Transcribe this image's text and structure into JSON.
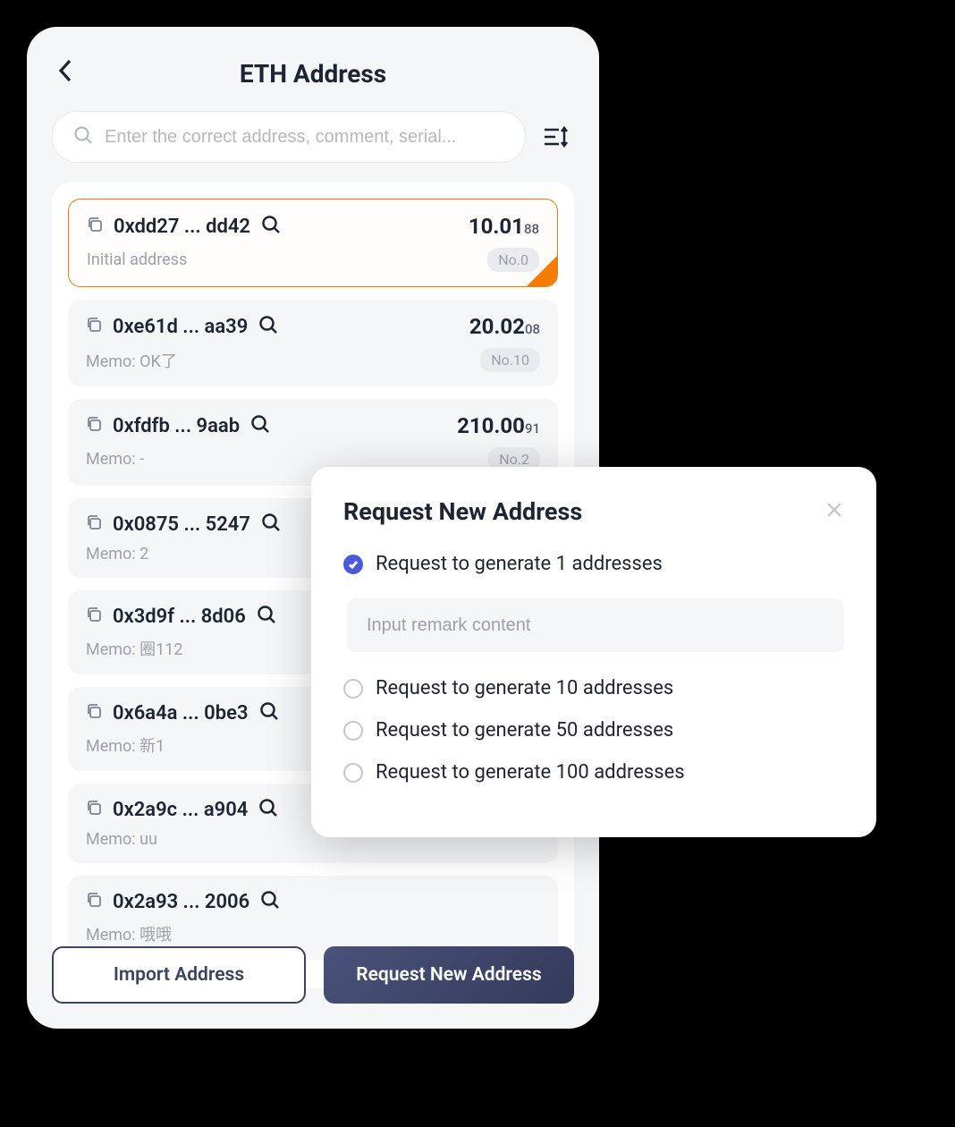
{
  "header": {
    "title": "ETH Address"
  },
  "search": {
    "placeholder": "Enter the correct address, comment, serial..."
  },
  "addresses": [
    {
      "addr": "0xdd27 ... dd42",
      "balance": "10.01",
      "balance_sub": "88",
      "memo": "Initial address",
      "no": "No.0",
      "selected": true
    },
    {
      "addr": "0xe61d ... aa39",
      "balance": "20.02",
      "balance_sub": "08",
      "memo": "Memo: OK了",
      "no": "No.10",
      "selected": false
    },
    {
      "addr": "0xfdfb ... 9aab",
      "balance": "210.00",
      "balance_sub": "91",
      "memo": "Memo: -",
      "no": "No.2",
      "selected": false
    },
    {
      "addr": "0x0875 ... 5247",
      "balance": "",
      "balance_sub": "",
      "memo": "Memo: 2",
      "no": "",
      "selected": false
    },
    {
      "addr": "0x3d9f ... 8d06",
      "balance": "",
      "balance_sub": "",
      "memo": "Memo: 圈112",
      "no": "",
      "selected": false
    },
    {
      "addr": "0x6a4a ... 0be3",
      "balance": "",
      "balance_sub": "",
      "memo": "Memo: 新1",
      "no": "",
      "selected": false
    },
    {
      "addr": "0x2a9c ... a904",
      "balance": "",
      "balance_sub": "",
      "memo": "Memo: uu",
      "no": "",
      "selected": false
    },
    {
      "addr": "0x2a93 ... 2006",
      "balance": "",
      "balance_sub": "",
      "memo": "Memo: 哦哦",
      "no": "",
      "selected": false
    }
  ],
  "footer": {
    "import_label": "Import Address",
    "request_label": "Request New Address"
  },
  "modal": {
    "title": "Request New Address",
    "options": [
      {
        "label": "Request to generate 1 addresses",
        "checked": true
      },
      {
        "label": "Request to generate 10 addresses",
        "checked": false
      },
      {
        "label": "Request to generate 50 addresses",
        "checked": false
      },
      {
        "label": "Request to generate 100 addresses",
        "checked": false
      }
    ],
    "remark_placeholder": "Input remark content"
  }
}
